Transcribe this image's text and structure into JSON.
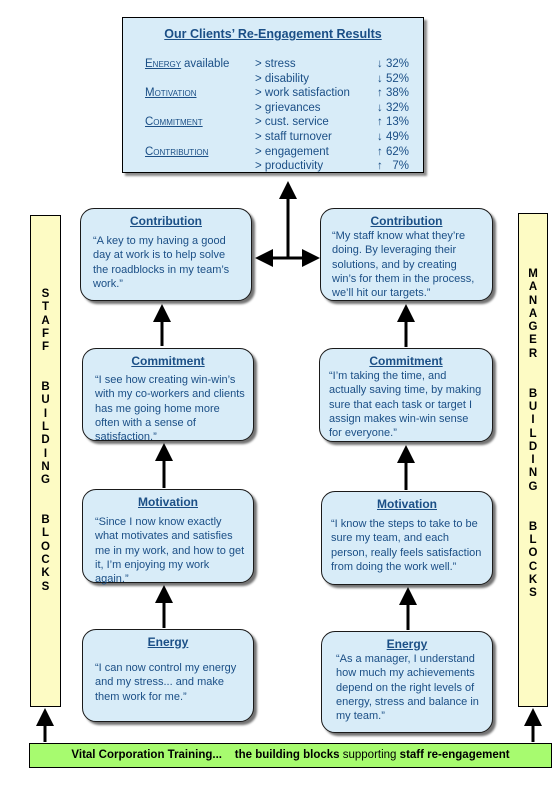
{
  "results": {
    "title": "Our Clients’ Re-Engagement Results",
    "rows": [
      {
        "category": "Energy",
        "category_suffix": " available",
        "metric": "> stress",
        "direction": "↓",
        "value": "32%"
      },
      {
        "category": "",
        "category_suffix": "",
        "metric": "> disability",
        "direction": "↓",
        "value": "52%"
      },
      {
        "category": "Motivation",
        "category_suffix": "",
        "metric": "> work satisfaction",
        "direction": "↑",
        "value": "38%"
      },
      {
        "category": "",
        "category_suffix": "",
        "metric": "> grievances",
        "direction": "↓",
        "value": "32%"
      },
      {
        "category": "Commitment",
        "category_suffix": "",
        "metric": "> cust. service",
        "direction": "↑",
        "value": "13%"
      },
      {
        "category": "",
        "category_suffix": "",
        "metric": "> staff turnover",
        "direction": "↓",
        "value": "49%"
      },
      {
        "category": "Contribution",
        "category_suffix": "",
        "metric": "> engagement",
        "direction": "↑",
        "value": "62%"
      },
      {
        "category": "",
        "category_suffix": "",
        "metric": "> productivity",
        "direction": "↑",
        "value": "  7%"
      }
    ]
  },
  "staff": {
    "sidebar_label": "STAFF BUILDING BLOCKS",
    "sidebar_lines": [
      "S",
      "T",
      "A",
      "F",
      "F",
      "",
      "",
      "B",
      "U",
      "I",
      "L",
      "D",
      "I",
      "N",
      "G",
      "",
      "",
      "B",
      "L",
      "O",
      "C",
      "K",
      "S"
    ],
    "boxes": [
      {
        "title": "Contribution",
        "quote": "“A key to my having a good day at work is to help solve the roadblocks in my team’s work.”"
      },
      {
        "title": "Commitment",
        "quote": "“I see how creating win-win’s with my co-workers and clients has me going home more often with a sense of satisfaction.”"
      },
      {
        "title": "Motivation",
        "quote": "“Since I now know exactly what motivates and satisfies me in my work, and how to get it, I’m enjoying my work again.”"
      },
      {
        "title": "Energy",
        "quote": "“I can now control my energy and my stress... and make them work for me.”"
      }
    ]
  },
  "manager": {
    "sidebar_label": "MANAGER BUILDING BLOCKS",
    "sidebar_lines": [
      "M",
      "A",
      "N",
      "A",
      "G",
      "E",
      "R",
      "",
      "",
      "B",
      "U",
      "I",
      "L",
      "D",
      "I",
      "N",
      "G",
      "",
      "",
      "B",
      "L",
      "O",
      "C",
      "K",
      "S"
    ],
    "boxes": [
      {
        "title": "Contribution",
        "quote": "“My staff know what they’re doing. By leveraging their solutions, and by creating win’s for them in the process, we’ll hit our targets.”"
      },
      {
        "title": "Commitment",
        "quote": "“I’m taking the time, and actually saving time, by making sure that each task or target I assign makes win-win sense for everyone.”"
      },
      {
        "title": "Motivation",
        "quote": "“I know the steps to take to be sure my team, and each person, really feels satisfaction from doing the work well.”"
      },
      {
        "title": "Energy",
        "quote": "“As a manager, I understand how much my achievements depend on the right levels of energy, stress and balance in my team.”"
      }
    ]
  },
  "footer": {
    "part1": "Vital Corporation Training...",
    "part2": "the building blocks",
    "part3": "supporting",
    "part4": "staff re-engagement"
  },
  "colors": {
    "box_fill": "#d8ecf8",
    "text_blue": "#1b4f86",
    "sidebar_fill": "#fdfbc4",
    "footer_fill": "#a7fb6f"
  }
}
